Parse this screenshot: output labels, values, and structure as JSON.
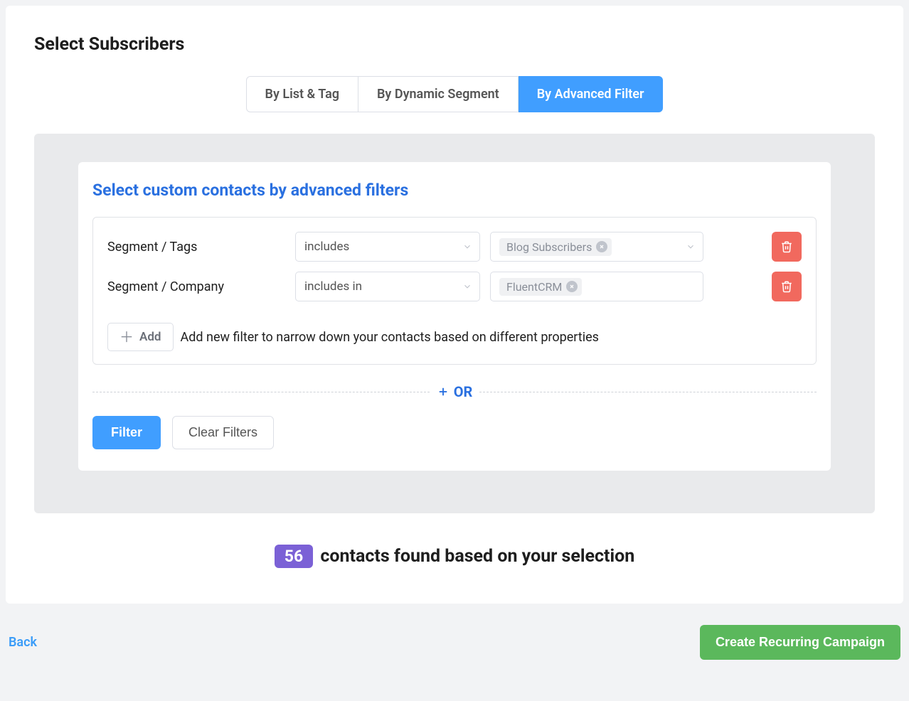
{
  "page_title": "Select Subscribers",
  "tabs": {
    "items": [
      {
        "label": "By List & Tag"
      },
      {
        "label": "By Dynamic Segment"
      },
      {
        "label": "By Advanced Filter"
      }
    ],
    "active_index": 2
  },
  "filter_panel": {
    "title": "Select custom contacts by advanced filters",
    "rows": [
      {
        "label": "Segment / Tags",
        "operator": "includes",
        "tags": [
          "Blog Subscribers"
        ]
      },
      {
        "label": "Segment / Company",
        "operator": "includes in",
        "tags": [
          "FluentCRM"
        ]
      }
    ],
    "add_button_label": "Add",
    "add_hint": "Add new filter to narrow down your contacts based on different properties",
    "or_label": "OR",
    "filter_button": "Filter",
    "clear_button": "Clear Filters"
  },
  "summary": {
    "count": "56",
    "text": "contacts found based on your selection"
  },
  "footer": {
    "back_label": "Back",
    "create_label": "Create Recurring Campaign"
  }
}
